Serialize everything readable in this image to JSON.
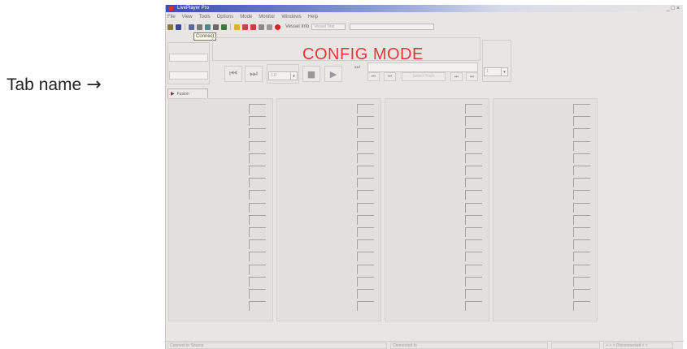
{
  "annotation": {
    "label": "Tab name",
    "arrow": "→"
  },
  "app": {
    "title": "LivePlayer Pro",
    "window_controls": [
      "_",
      "□",
      "×"
    ]
  },
  "menu": [
    "File",
    "View",
    "Tools",
    "Options",
    "Mode",
    "Monitor",
    "Windows",
    "Help"
  ],
  "toolbar": {
    "icons": [
      "open-icon",
      "save-icon",
      "connect-icon",
      "disconnect-icon",
      "record-icon",
      "grid-icon",
      "sound-icon",
      "pencil-icon",
      "flag-icon",
      "tools-icon",
      "list-icon",
      "gear-icon",
      "stop-icon"
    ],
    "vessel_label": "Vessel Info",
    "vessel_value": "Vessel Test",
    "tooltip": "Connect"
  },
  "panel": {
    "config_mode": "CONFIG MODE",
    "buttons": {
      "skip_back": "⏮",
      "skip_fwd": "⏭",
      "stop": "■",
      "play": "▶"
    },
    "select_track": "Select Track",
    "speed_combo": "1.0",
    "right_combo": "1",
    "colors": {
      "config_mode": "#e8373a"
    }
  },
  "tab": {
    "label": "Fusion",
    "marker": "▶"
  },
  "columns": {
    "count": 4,
    "slots_per_column": 17
  },
  "status": {
    "left": "Connect to Source",
    "middle": "Connected to",
    "right": "> > > Disconnected < <"
  }
}
